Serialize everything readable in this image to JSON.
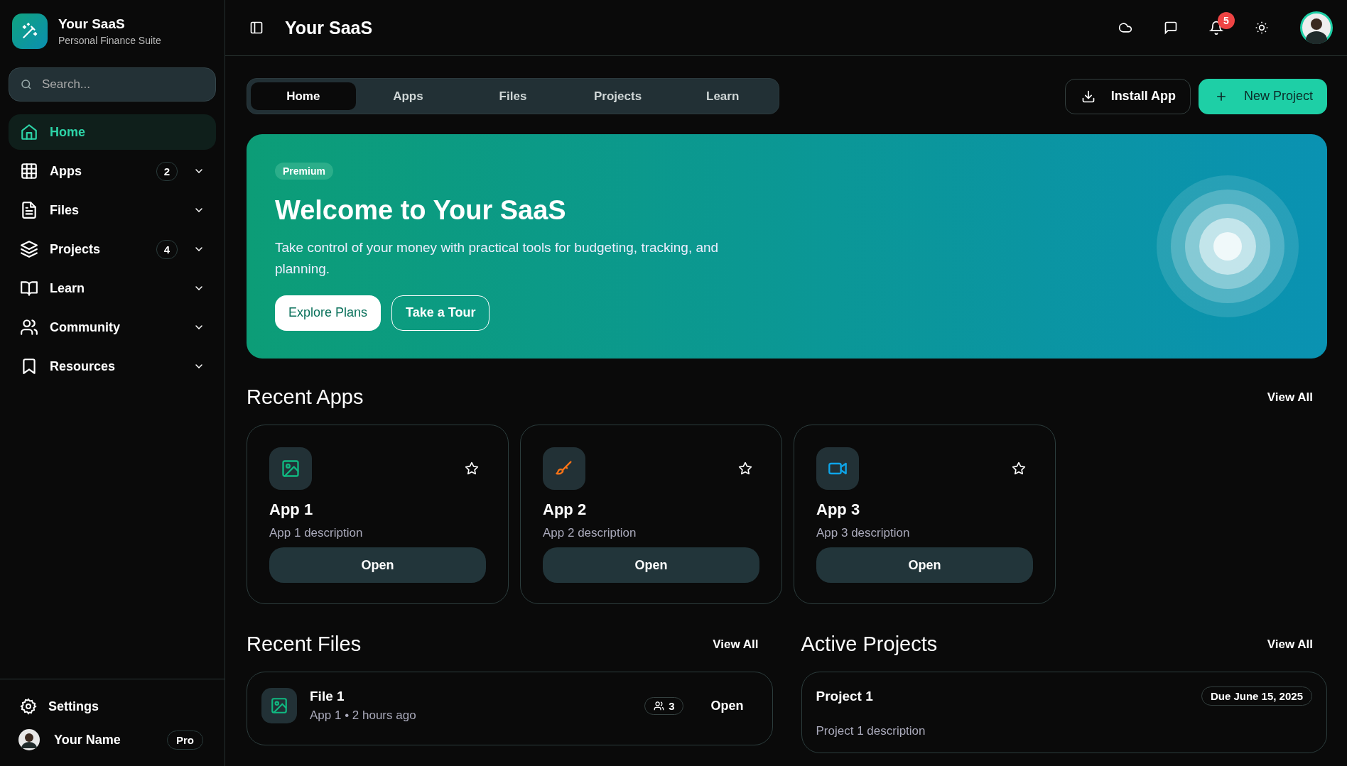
{
  "brand": {
    "name": "Your SaaS",
    "tagline": "Personal Finance Suite"
  },
  "search": {
    "placeholder": "Search..."
  },
  "nav": [
    {
      "label": "Home",
      "selected": true
    },
    {
      "label": "Apps",
      "selected": false,
      "badge": "2",
      "expanded": false
    },
    {
      "label": "Files",
      "selected": false,
      "expanded": false
    },
    {
      "label": "Projects",
      "selected": false,
      "badge": "4",
      "expanded": false
    },
    {
      "label": "Learn",
      "selected": false,
      "expanded": false
    },
    {
      "label": "Community",
      "selected": false,
      "expanded": false
    },
    {
      "label": "Resources",
      "selected": false,
      "expanded": false
    }
  ],
  "settings": {
    "label": "Settings"
  },
  "user": {
    "name": "Your Name",
    "plan": "Pro"
  },
  "header": {
    "title": "Your SaaS",
    "notifications": "5"
  },
  "tabs": [
    {
      "label": "Home",
      "selected": true
    },
    {
      "label": "Apps",
      "selected": false
    },
    {
      "label": "Files",
      "selected": false
    },
    {
      "label": "Projects",
      "selected": false
    },
    {
      "label": "Learn",
      "selected": false
    }
  ],
  "actions": {
    "install": "Install App",
    "new": "New Project"
  },
  "banner": {
    "tag": "Premium",
    "title": "Welcome to Your SaaS",
    "text": "Take control of your money with practical tools for budgeting, tracking, and planning.",
    "primary": "Explore Plans",
    "secondary": "Take a Tour"
  },
  "recent_apps": {
    "title": "Recent Apps",
    "view_all": "View All",
    "items": [
      {
        "name": "App 1",
        "description": "App 1 description",
        "button": "Open",
        "color": "#10b981",
        "starred": false
      },
      {
        "name": "App 2",
        "description": "App 2 description",
        "button": "Open",
        "color": "#f97316",
        "starred": false
      },
      {
        "name": "App 3",
        "description": "App 3 description",
        "button": "Open",
        "color": "#0ea5e9",
        "starred": false
      }
    ]
  },
  "recent_files": {
    "title": "Recent Files",
    "view_all": "View All",
    "items": [
      {
        "name": "File 1",
        "meta": "App 1 • 2 hours ago",
        "shared": "3",
        "button": "Open"
      }
    ]
  },
  "active_projects": {
    "title": "Active Projects",
    "view_all": "View All",
    "items": [
      {
        "name": "Project 1",
        "due": "Due June 15, 2025",
        "description": "Project 1 description"
      }
    ]
  }
}
